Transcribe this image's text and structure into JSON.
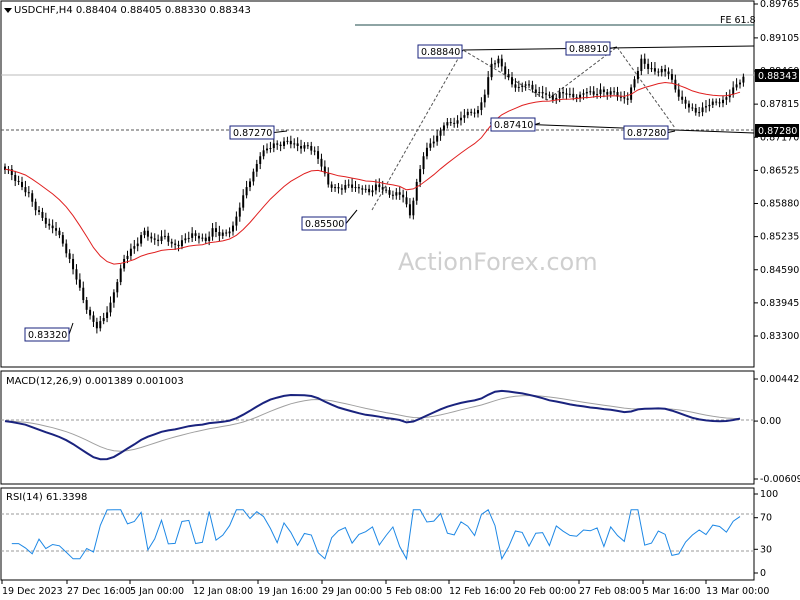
{
  "chart_data": [
    {
      "type": "candlestick",
      "title": "USDCHF,H4  0.88404 0.88405 0.88330 0.88343",
      "current_price_label": "0.88343",
      "level_label": "0.87280",
      "fe_label": "FE 61.8",
      "y_ticks": [
        "0.89765",
        "0.89105",
        "0.88460",
        "0.87815",
        "0.87170",
        "0.86525",
        "0.85880",
        "0.85235",
        "0.84590",
        "0.83945",
        "0.83300"
      ],
      "ylim": [
        0.8283,
        0.898
      ],
      "x_ticks": [
        "19 Dec 2023",
        "27 Dec 16:00",
        "5 Jan 00:00",
        "12 Jan 08:00",
        "19 Jan 16:00",
        "29 Jan 00:00",
        "5 Feb 08:00",
        "12 Feb 16:00",
        "20 Feb 00:00",
        "27 Feb 08:00",
        "5 Mar 16:00",
        "13 Mar 00:00"
      ],
      "annotations": [
        "0.88840",
        "0.88910",
        "0.87270",
        "0.87410",
        "0.87280",
        "0.85500",
        "0.83320"
      ],
      "closes": [
        0.8655,
        0.8632,
        0.862,
        0.8608,
        0.8575,
        0.856,
        0.8545,
        0.8535,
        0.851,
        0.848,
        0.844,
        0.84,
        0.837,
        0.8345,
        0.8365,
        0.8395,
        0.8435,
        0.848,
        0.85,
        0.851,
        0.8535,
        0.852,
        0.8515,
        0.8525,
        0.851,
        0.8505,
        0.852,
        0.853,
        0.852,
        0.8515,
        0.854,
        0.8525,
        0.853,
        0.8545,
        0.858,
        0.862,
        0.865,
        0.868,
        0.8695,
        0.8705,
        0.87,
        0.871,
        0.8705,
        0.8695,
        0.87,
        0.869,
        0.866,
        0.8625,
        0.862,
        0.8615,
        0.8625,
        0.862,
        0.8615,
        0.861,
        0.8625,
        0.8615,
        0.8605,
        0.861,
        0.86,
        0.8565,
        0.863,
        0.868,
        0.8705,
        0.872,
        0.874,
        0.8745,
        0.875,
        0.876,
        0.8765,
        0.877,
        0.88,
        0.886,
        0.887,
        0.884,
        0.882,
        0.8815,
        0.882,
        0.881,
        0.8805,
        0.88,
        0.879,
        0.8805,
        0.88,
        0.8795,
        0.88,
        0.8805,
        0.88,
        0.881,
        0.88,
        0.8805,
        0.8795,
        0.879,
        0.883,
        0.887,
        0.885,
        0.8845,
        0.885,
        0.884,
        0.881,
        0.879,
        0.8775,
        0.8765,
        0.8775,
        0.878,
        0.8785,
        0.879,
        0.88,
        0.882,
        0.8835
      ],
      "ma_label": "",
      "indicators": [
        {
          "type": "line",
          "title": "MACD(12,26,9) 0.001389 0.001003",
          "y_ticks": [
            "0.004425",
            "0.00",
            "-0.006092"
          ],
          "ylim": [
            -0.0075,
            0.0053
          ],
          "macd_last": 0.001389,
          "signal_last": 0.001003
        },
        {
          "type": "line",
          "title": "RSI(14) 61.3398",
          "y_ticks": [
            "100",
            "70",
            "30",
            "0"
          ],
          "ylim": [
            0,
            100
          ],
          "levels": [
            70,
            30
          ],
          "last": 61.3398
        }
      ]
    }
  ],
  "watermark": "ActionForex.com",
  "colors": {
    "candle": "#000000",
    "ma": "#e02020",
    "macd": "#1a237e",
    "signal": "#a0a0a0",
    "rsi": "#1e88e5",
    "trend": "#000000",
    "dotted": "#555555"
  }
}
